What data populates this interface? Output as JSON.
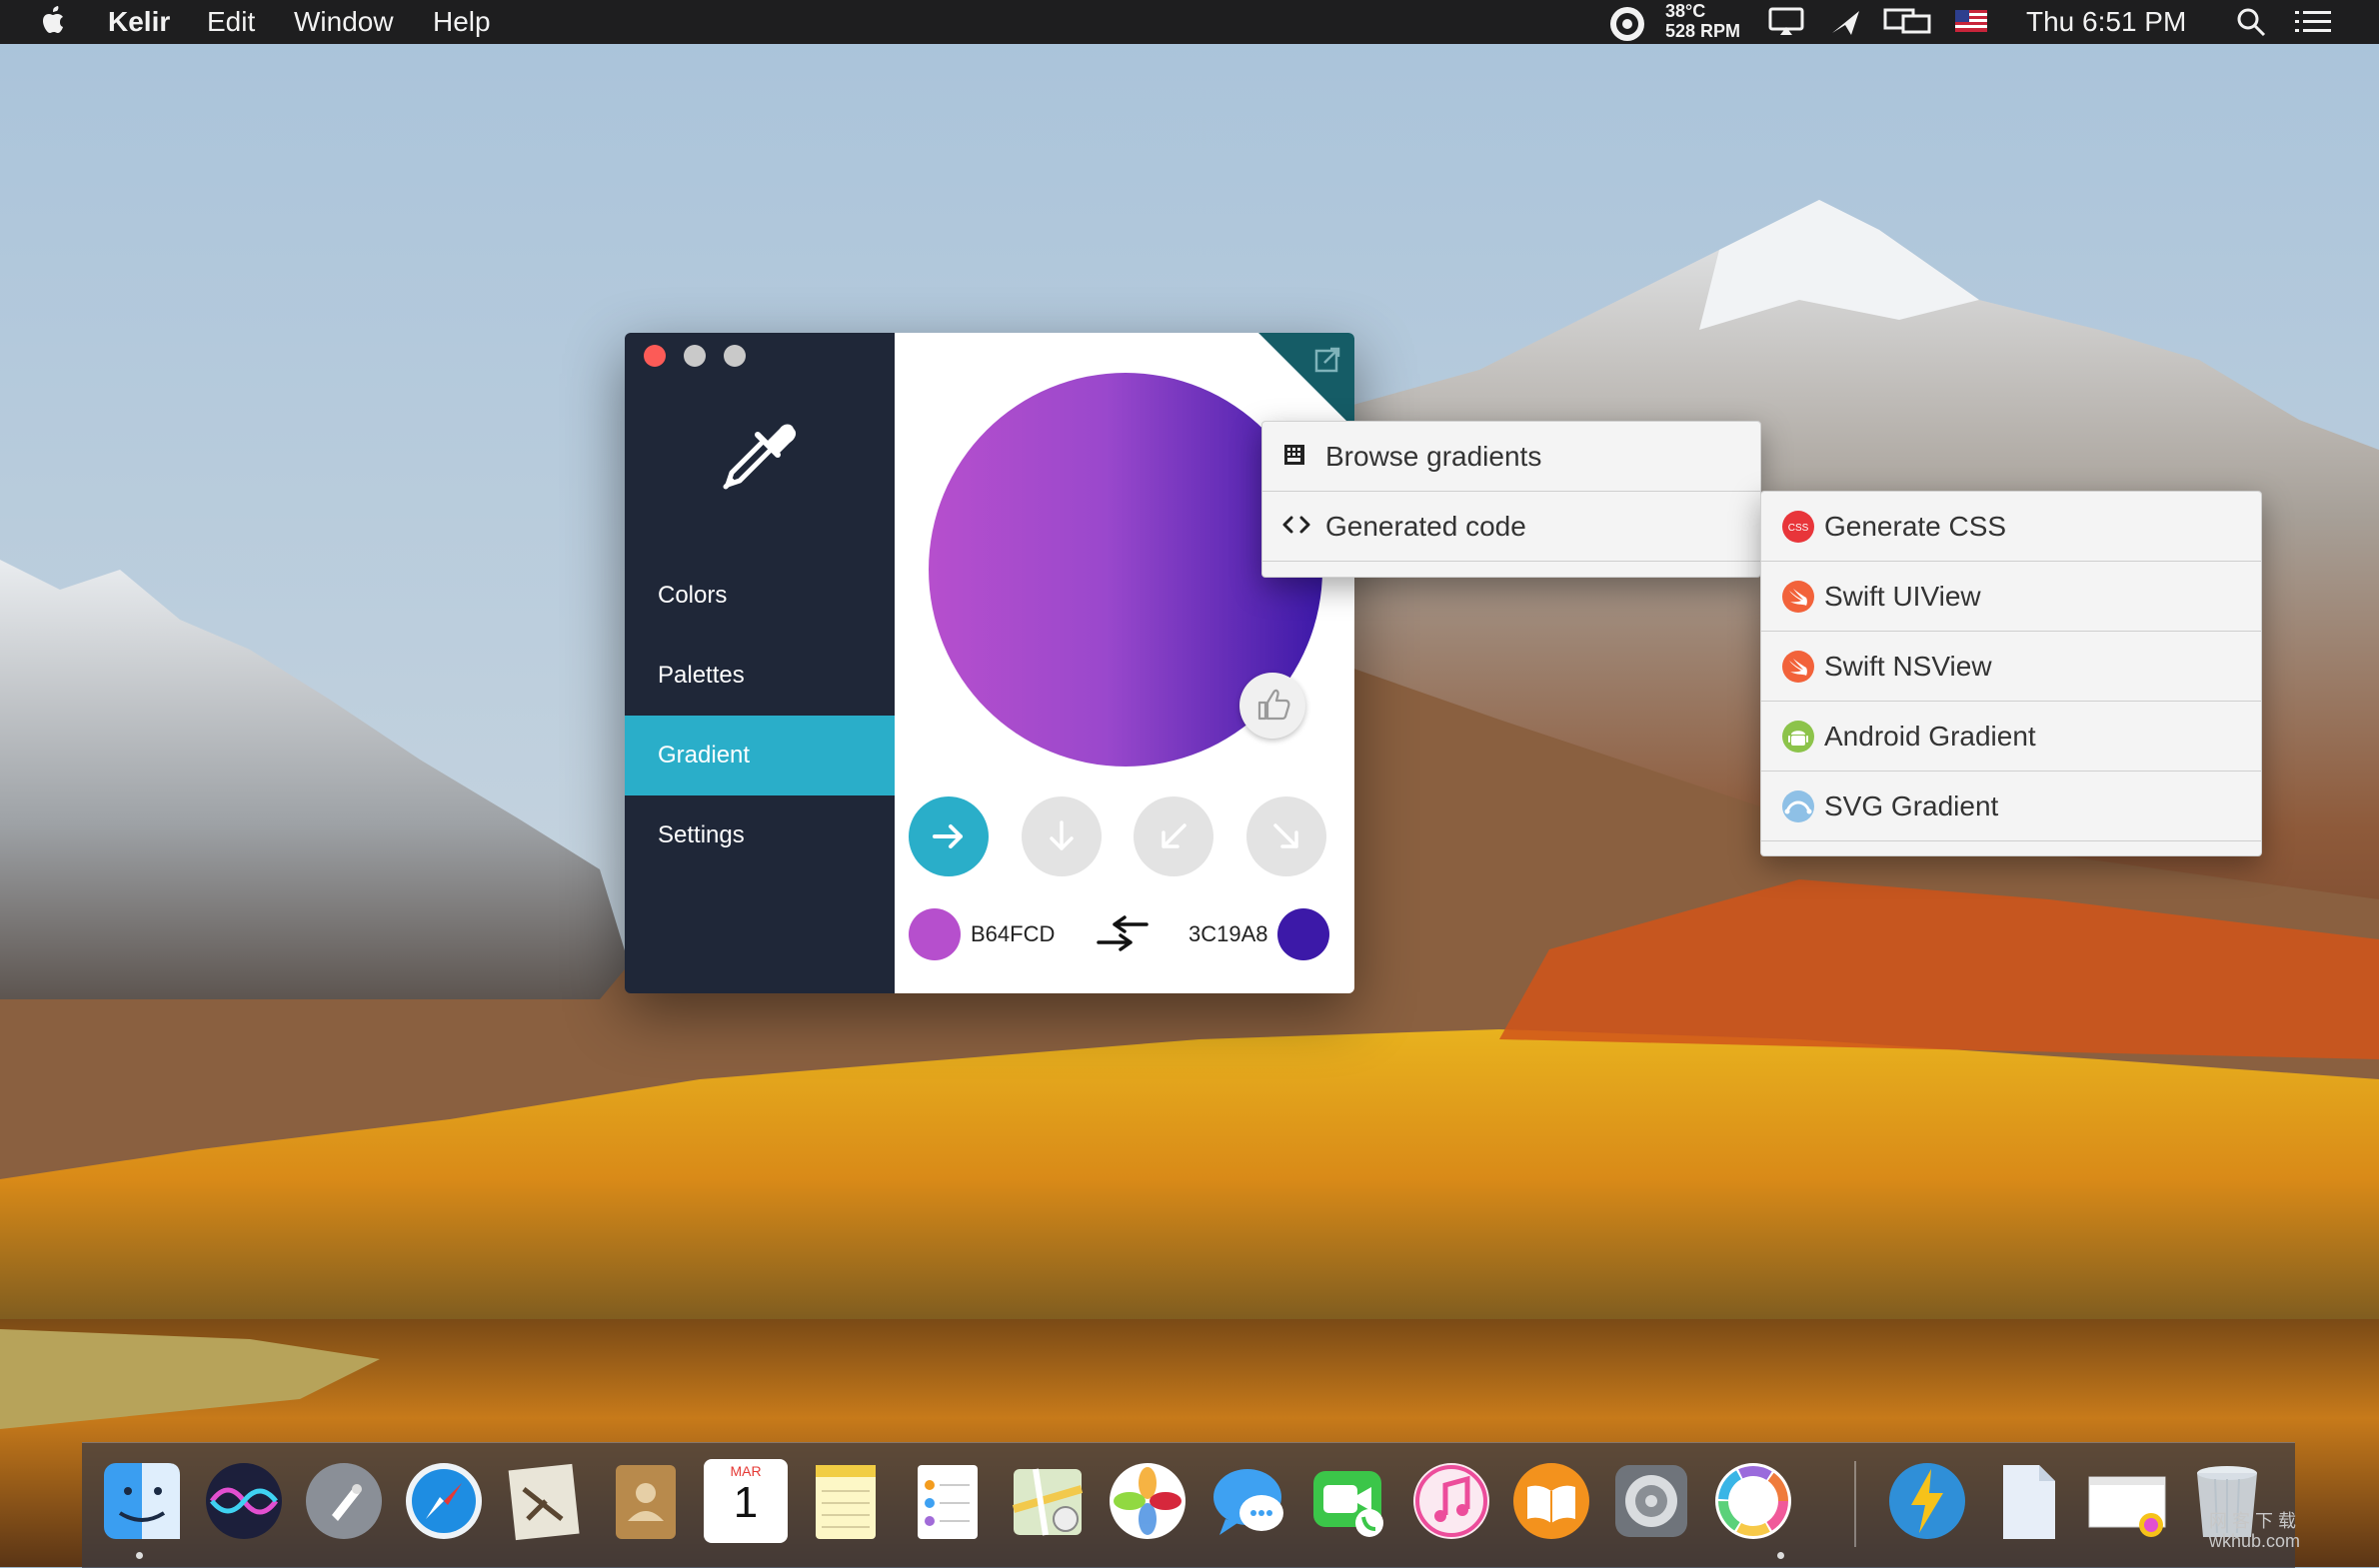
{
  "menubar": {
    "apple": "apple-icon",
    "app_name": "Kelir",
    "menus": [
      "Edit",
      "Window",
      "Help"
    ],
    "temperature": "38°C",
    "fan_speed": "528 RPM",
    "clock": "Thu 6:51 PM",
    "status_icons": [
      "fan-monitor-icon",
      "display-notification-icon",
      "airplay-icon",
      "screen-mirroring-icon",
      "us-flag-icon",
      "spotlight-search-icon",
      "notification-center-icon"
    ]
  },
  "window": {
    "sidebar": {
      "logo": "eyedropper-icon",
      "items": [
        {
          "label": "Colors",
          "active": false
        },
        {
          "label": "Palettes",
          "active": false
        },
        {
          "label": "Gradient",
          "active": true
        },
        {
          "label": "Settings",
          "active": false
        }
      ]
    },
    "gradient": {
      "start_color": "#B64FCD",
      "end_color": "#3C19A8",
      "start_hex": "B64FCD",
      "end_hex": "3C19A8",
      "directions": [
        "arrow-right-icon",
        "arrow-down-icon",
        "arrow-down-left-icon",
        "arrow-down-right-icon"
      ],
      "active_direction": "arrow-right-icon"
    },
    "accent": "#2AAEC9",
    "sidebar_bg": "#1F2738"
  },
  "context_menu": {
    "items": [
      {
        "label": "Browse gradients",
        "icon": "grid-icon"
      },
      {
        "label": "Generated code",
        "icon": "code-brackets-icon"
      }
    ]
  },
  "submenu": {
    "items": [
      {
        "label": "Generate CSS",
        "icon": "css-icon"
      },
      {
        "label": "Swift UIView",
        "icon": "swift-icon"
      },
      {
        "label": "Swift NSView",
        "icon": "swift-icon"
      },
      {
        "label": "Android Gradient",
        "icon": "android-icon"
      },
      {
        "label": "SVG Gradient",
        "icon": "svg-icon"
      }
    ]
  },
  "dock": {
    "apps": [
      "Finder",
      "Siri",
      "Launchpad",
      "Safari",
      "Mail",
      "Contacts",
      "Calendar",
      "Notes",
      "Reminders",
      "Maps",
      "Photos",
      "Messages",
      "FaceTime",
      "iTunes",
      "iBooks",
      "System Preferences",
      "Kelir",
      "Reeder",
      "Document",
      "Preview",
      "Trash"
    ],
    "calendar_month": "MAR",
    "calendar_day": "1"
  },
  "watermark": {
    "line1": "网 客 下 载",
    "line2": "wkhub.com"
  }
}
